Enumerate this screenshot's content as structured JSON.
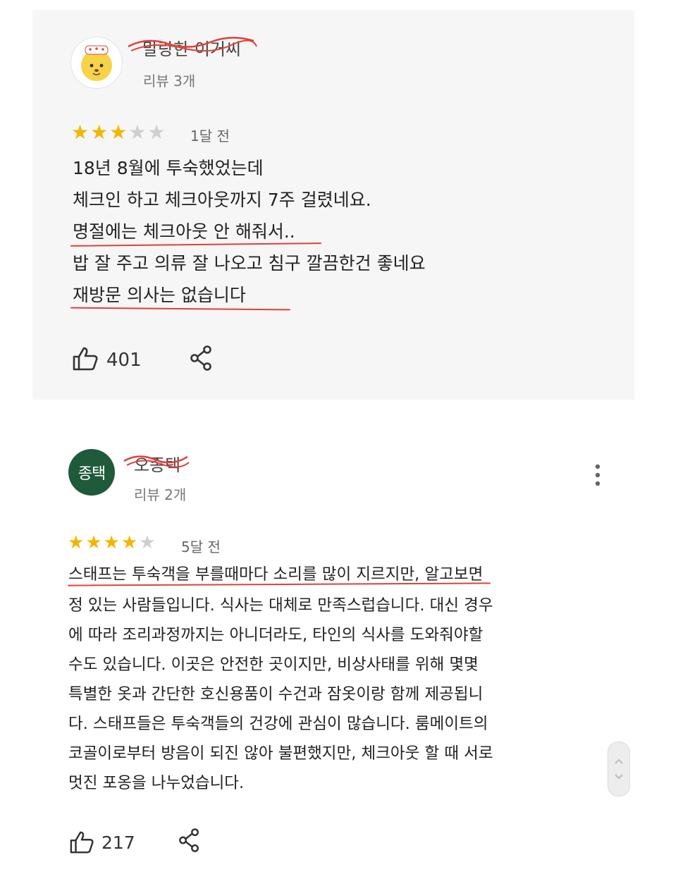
{
  "reviews": [
    {
      "reviewer_name": "말랑한 이거씨",
      "review_count": "리뷰 3개",
      "rating": 3,
      "time_ago": "1달 전",
      "lines": [
        "18년 8월에 투숙했었는데",
        "체크인 하고 체크아웃까지 7주 걸렸네요.",
        "명절에는 체크아웃 안 해줘서..",
        "밥 잘 주고 의류 잘 나오고 침구 깔끔한건 좋네요",
        "재방문 의사는 없습니다"
      ],
      "likes": "401"
    },
    {
      "avatar_text": "종택",
      "reviewer_name": "오종택",
      "review_count": "리뷰 2개",
      "rating": 4,
      "time_ago": "5달 전",
      "lines": [
        "스태프는 투숙객을 부를때마다 소리를 많이 지르지만, 알고보면",
        "정 있는 사람들입니다. 식사는 대체로 만족스럽습니다. 대신 경우",
        "에 따라 조리과정까지는 아니더라도, 타인의 식사를 도와줘야할",
        "수도 있습니다. 이곳은 안전한 곳이지만, 비상사태를 위해 몇몇",
        "특별한 옷과 간단한 호신용품이 수건과 잠옷이랑 함께 제공됩니",
        "다. 스태프들은 투숙객들의 건강에 관심이 많습니다. 룸메이트의",
        "코골이로부터 방음이 되진 않아 불편했지만, 체크아웃 할 때 서로",
        "멋진 포옹을 나누었습니다."
      ],
      "likes": "217"
    }
  ],
  "colors": {
    "star_on": "#f2b600",
    "star_off": "#cfcfcf",
    "scribble_red": "#e0403a",
    "avatar_green": "#1f5a3a"
  },
  "icons": [
    "thumbs-up-icon",
    "share-icon",
    "more-vert-icon",
    "chevron-up-icon",
    "chevron-down-icon"
  ]
}
